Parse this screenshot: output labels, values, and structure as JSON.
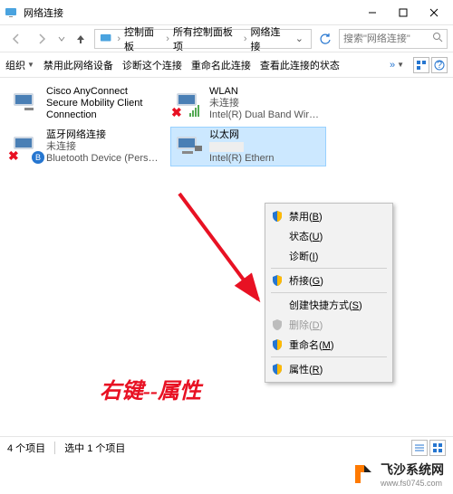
{
  "window": {
    "title": "网络连接"
  },
  "addressbar": {
    "segments": [
      "控制面板",
      "所有控制面板项",
      "网络连接"
    ],
    "search_placeholder": "搜索\"网络连接\""
  },
  "toolbar": {
    "label_organize": "组织",
    "items": [
      "禁用此网络设备",
      "诊断这个连接",
      "重命名此连接",
      "查看此连接的状态"
    ],
    "overflow": "»"
  },
  "connections": [
    {
      "name": "Cisco AnyConnect Secure Mobility Client Connection",
      "status": "",
      "device": "",
      "disabled": false,
      "selected": false,
      "kind": "vpn"
    },
    {
      "name": "WLAN",
      "status": "未连接",
      "device": "Intel(R) Dual Band Wireless-A...",
      "disabled": true,
      "selected": false,
      "kind": "wifi"
    },
    {
      "name": "蓝牙网络连接",
      "status": "未连接",
      "device": "Bluetooth Device (Personal Ar...",
      "disabled": true,
      "selected": false,
      "kind": "bluetooth"
    },
    {
      "name": "以太网",
      "status": "",
      "device": "Intel(R) Ethern",
      "disabled": false,
      "selected": true,
      "kind": "ethernet"
    }
  ],
  "context_menu": {
    "items": [
      {
        "label": "禁用",
        "hotkey": "B",
        "shield": true,
        "disabled": false
      },
      {
        "label": "状态",
        "hotkey": "U",
        "shield": false,
        "disabled": false
      },
      {
        "label": "诊断",
        "hotkey": "I",
        "shield": false,
        "disabled": false
      },
      {
        "sep": true
      },
      {
        "label": "桥接",
        "hotkey": "G",
        "shield": true,
        "disabled": false
      },
      {
        "sep": true
      },
      {
        "label": "创建快捷方式",
        "hotkey": "S",
        "shield": false,
        "disabled": false
      },
      {
        "label": "删除",
        "hotkey": "D",
        "shield": true,
        "disabled": true
      },
      {
        "label": "重命名",
        "hotkey": "M",
        "shield": true,
        "disabled": false
      },
      {
        "sep": true
      },
      {
        "label": "属性",
        "hotkey": "R",
        "shield": true,
        "disabled": false
      }
    ]
  },
  "annotation": "右键--属性",
  "statusbar": {
    "count": "4 个项目",
    "selected": "选中 1 个项目"
  },
  "watermark": {
    "title": "飞沙系统网",
    "subtitle": "www.fs0745.com"
  }
}
